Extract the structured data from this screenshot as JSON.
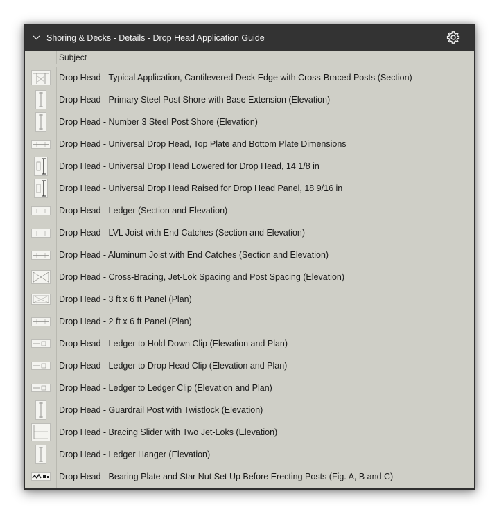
{
  "panel": {
    "title": "Shoring & Decks - Details - Drop Head Application Guide",
    "collapse_icon": "chevron-down-icon",
    "settings_icon": "gear-icon"
  },
  "table": {
    "column_header": "Subject",
    "rows": [
      {
        "label": "Drop Head - Typical Application, Cantilevered Deck Edge with Cross-Braced Posts (Section)",
        "thumb": "wide"
      },
      {
        "label": "Drop Head - Primary Steel Post Shore with Base Extension (Elevation)",
        "thumb": "tall"
      },
      {
        "label": "Drop Head - Number 3 Steel Post Shore (Elevation)",
        "thumb": "tall"
      },
      {
        "label": "Drop Head - Universal Drop Head, Top Plate and Bottom Plate Dimensions",
        "thumb": "flat"
      },
      {
        "label": "Drop Head - Universal Drop Head Lowered for Drop Head, 14 1/8 in",
        "thumb": "post"
      },
      {
        "label": "Drop Head - Universal Drop Head Raised for Drop Head Panel, 18 9/16 in",
        "thumb": "post"
      },
      {
        "label": "Drop Head - Ledger (Section and Elevation)",
        "thumb": "flat"
      },
      {
        "label": "Drop Head - LVL Joist with End Catches (Section and Elevation)",
        "thumb": "flat"
      },
      {
        "label": "Drop Head - Aluminum Joist with End Catches (Section and Elevation)",
        "thumb": "flat"
      },
      {
        "label": "Drop Head - Cross-Bracing, Jet-Lok Spacing and Post Spacing (Elevation)",
        "thumb": "cross"
      },
      {
        "label": "Drop Head - 3 ft x 6 ft Panel (Plan)",
        "thumb": "panel"
      },
      {
        "label": "Drop Head - 2 ft x 6 ft Panel (Plan)",
        "thumb": "flat"
      },
      {
        "label": "Drop Head - Ledger to Hold Down Clip (Elevation and Plan)",
        "thumb": "clip"
      },
      {
        "label": "Drop Head - Ledger to Drop Head Clip (Elevation and Plan)",
        "thumb": "clip"
      },
      {
        "label": "Drop Head - Ledger to Ledger Clip (Elevation and Plan)",
        "thumb": "clip"
      },
      {
        "label": "Drop Head - Guardrail Post with Twistlock (Elevation)",
        "thumb": "tall"
      },
      {
        "label": "Drop Head - Bracing Slider with Two Jet-Loks (Elevation)",
        "thumb": "box"
      },
      {
        "label": "Drop Head - Ledger Hanger (Elevation)",
        "thumb": "tall"
      },
      {
        "label": "Drop Head - Bearing Plate and Star Nut Set Up Before Erecting Posts (Fig. A, B and C)",
        "thumb": "dark"
      }
    ]
  }
}
